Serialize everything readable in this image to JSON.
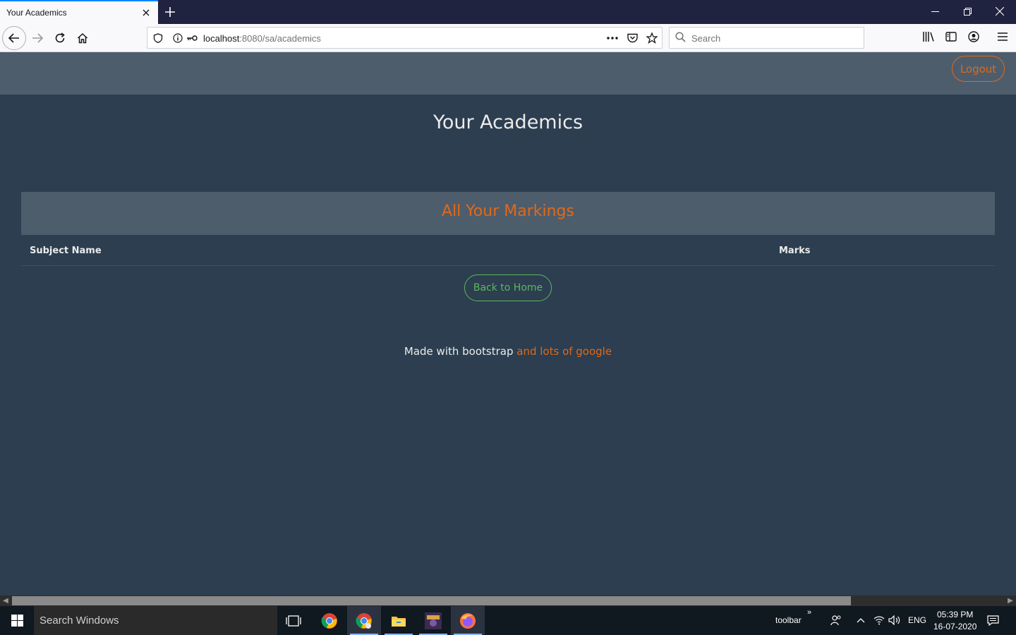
{
  "browser": {
    "tab_title": "Your Academics",
    "url_host": "localhost",
    "url_path": ":8080/sa/academics",
    "search_placeholder": "Search"
  },
  "site": {
    "logout_label": "Logout",
    "page_title": "Your Academics",
    "card_title": "All Your Markings",
    "table_headers": [
      "Subject Name",
      "Marks"
    ],
    "table_rows": [],
    "back_home_label": "Back to Home",
    "footer_text": "Made with bootstrap",
    "footer_accent": "and lots of google"
  },
  "taskbar": {
    "search_label": "Search Windows",
    "toolbar_label": "toolbar",
    "language": "ENG",
    "time": "05:39 PM",
    "date": "16-07-2020"
  },
  "colors": {
    "page_bg": "#2c3e50",
    "navbar_bg": "#4e5d6c",
    "accent_orange": "#df691a",
    "accent_green": "#5cb85c"
  }
}
